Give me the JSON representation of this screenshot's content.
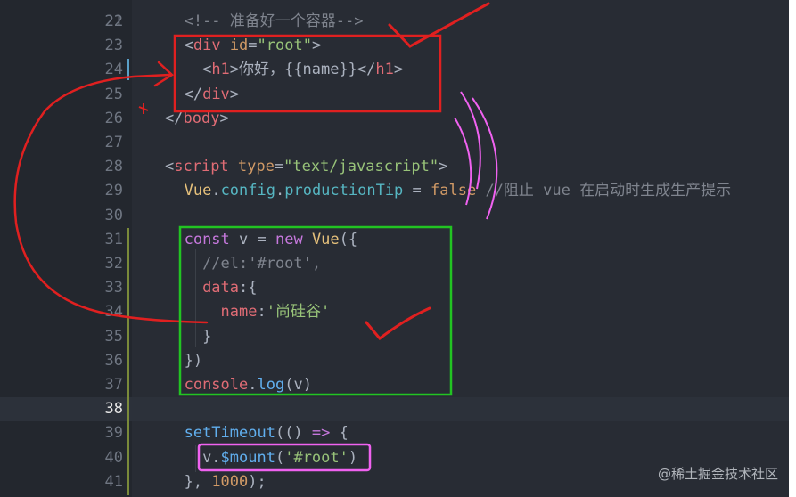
{
  "colors": {
    "editor_bg": "#282c34",
    "gutter_bg": "#23272e",
    "annotation_red": "#e02020",
    "annotation_green": "#22c422",
    "annotation_pink": "#f062f0"
  },
  "lines": [
    {
      "n": "22",
      "tokens": [
        {
          "t": "c",
          "v": "<!-- 准备好一个容器-->"
        }
      ]
    },
    {
      "n": "23",
      "tokens": [
        {
          "t": "p",
          "v": "<"
        },
        {
          "t": "tag",
          "v": "div"
        },
        {
          "t": "p",
          "v": " "
        },
        {
          "t": "attr",
          "v": "id"
        },
        {
          "t": "p",
          "v": "="
        },
        {
          "t": "str",
          "v": "\"root\""
        },
        {
          "t": "p",
          "v": ">"
        }
      ]
    },
    {
      "n": "24",
      "tokens": [
        {
          "t": "p",
          "v": "  <"
        },
        {
          "t": "tag",
          "v": "h1"
        },
        {
          "t": "p",
          "v": ">你好，{{name}}</"
        },
        {
          "t": "tag",
          "v": "h1"
        },
        {
          "t": "p",
          "v": ">"
        }
      ]
    },
    {
      "n": "25",
      "tokens": [
        {
          "t": "p",
          "v": "</"
        },
        {
          "t": "tag",
          "v": "div"
        },
        {
          "t": "p",
          "v": ">"
        }
      ]
    },
    {
      "n": "26",
      "tokens": [
        {
          "t": "p",
          "v": "</"
        },
        {
          "t": "tag",
          "v": "body"
        },
        {
          "t": "p",
          "v": ">"
        }
      ]
    },
    {
      "n": "27",
      "tokens": []
    },
    {
      "n": "28",
      "tokens": [
        {
          "t": "p",
          "v": "<"
        },
        {
          "t": "tag",
          "v": "script"
        },
        {
          "t": "p",
          "v": " "
        },
        {
          "t": "attr",
          "v": "type"
        },
        {
          "t": "p",
          "v": "="
        },
        {
          "t": "str",
          "v": "\"text/javascript\""
        },
        {
          "t": "p",
          "v": ">"
        }
      ]
    },
    {
      "n": "29",
      "tokens": [
        {
          "t": "cls",
          "v": "Vue"
        },
        {
          "t": "p",
          "v": "."
        },
        {
          "t": "prop",
          "v": "config"
        },
        {
          "t": "p",
          "v": "."
        },
        {
          "t": "prop",
          "v": "productionTip"
        },
        {
          "t": "p",
          "v": " = "
        },
        {
          "t": "num",
          "v": "false"
        },
        {
          "t": "p",
          "v": " "
        },
        {
          "t": "c",
          "v": "//阻止 vue 在启动时生成生产提示"
        }
      ]
    },
    {
      "n": "30",
      "tokens": []
    },
    {
      "n": "31",
      "tokens": [
        {
          "t": "kw",
          "v": "const"
        },
        {
          "t": "p",
          "v": " v = "
        },
        {
          "t": "kw",
          "v": "new"
        },
        {
          "t": "p",
          "v": " "
        },
        {
          "t": "cls",
          "v": "Vue"
        },
        {
          "t": "p",
          "v": "({"
        }
      ]
    },
    {
      "n": "32",
      "tokens": [
        {
          "t": "c",
          "v": "  //el:'#root',"
        }
      ]
    },
    {
      "n": "33",
      "tokens": [
        {
          "t": "tag",
          "v": "  data"
        },
        {
          "t": "p",
          "v": ":{"
        }
      ]
    },
    {
      "n": "34",
      "tokens": [
        {
          "t": "tag",
          "v": "    name"
        },
        {
          "t": "p",
          "v": ":"
        },
        {
          "t": "str",
          "v": "'尚硅谷'"
        }
      ]
    },
    {
      "n": "35",
      "tokens": [
        {
          "t": "p",
          "v": "  }"
        }
      ]
    },
    {
      "n": "36",
      "tokens": [
        {
          "t": "p",
          "v": "})"
        }
      ]
    },
    {
      "n": "37",
      "tokens": [
        {
          "t": "tag",
          "v": "console"
        },
        {
          "t": "p",
          "v": "."
        },
        {
          "t": "fn",
          "v": "log"
        },
        {
          "t": "p",
          "v": "(v)"
        }
      ]
    },
    {
      "n": "38",
      "tokens": []
    },
    {
      "n": "39",
      "tokens": [
        {
          "t": "fn",
          "v": "setTimeout"
        },
        {
          "t": "p",
          "v": "(() "
        },
        {
          "t": "kw",
          "v": "=>"
        },
        {
          "t": "p",
          "v": " {"
        }
      ]
    },
    {
      "n": "40",
      "tokens": [
        {
          "t": "p",
          "v": "  v."
        },
        {
          "t": "fn",
          "v": "$mount"
        },
        {
          "t": "p",
          "v": "("
        },
        {
          "t": "str",
          "v": "'#root'"
        },
        {
          "t": "p",
          "v": ")"
        }
      ]
    },
    {
      "n": "41",
      "tokens": [
        {
          "t": "p",
          "v": "}, "
        },
        {
          "t": "num",
          "v": "1000"
        },
        {
          "t": "p",
          "v": ");"
        }
      ]
    }
  ],
  "current_line": "38",
  "watermark": "@稀土掘金技术社区"
}
